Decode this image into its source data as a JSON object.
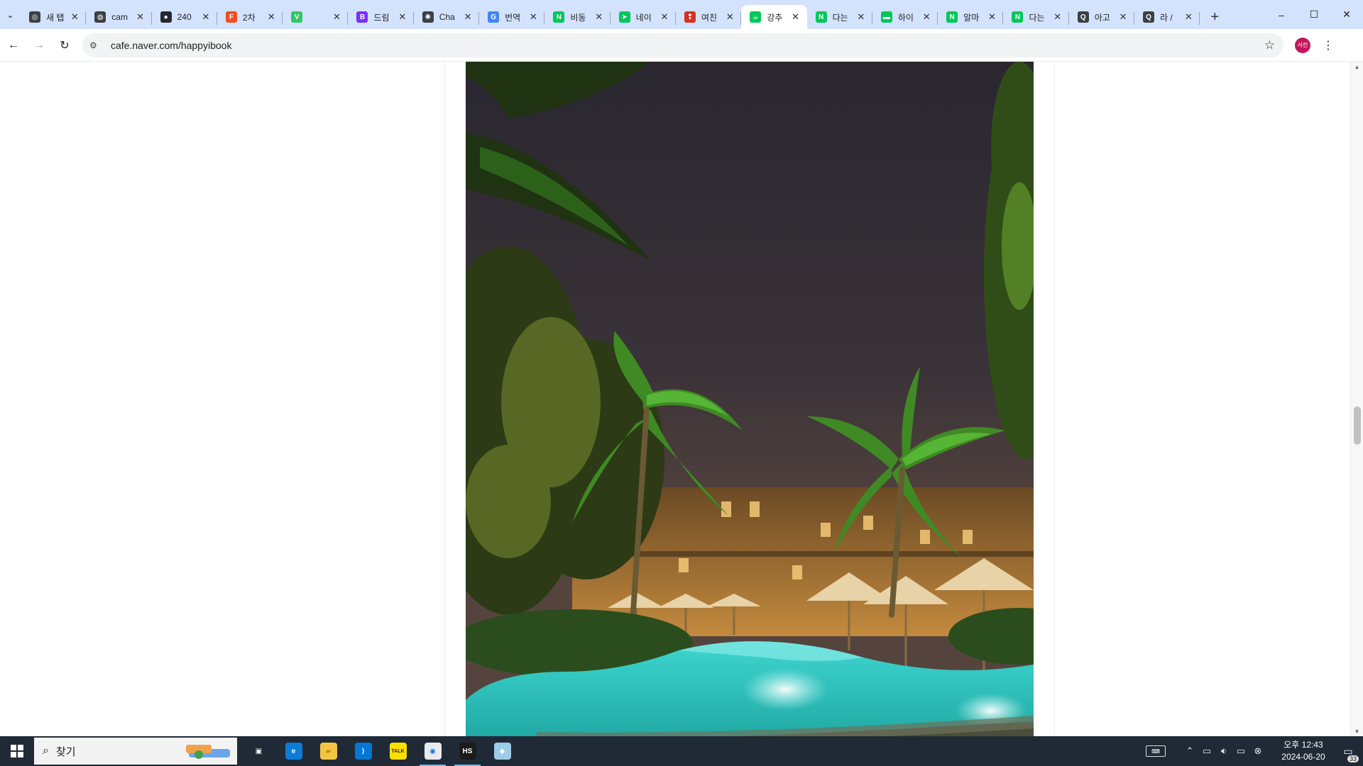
{
  "browser": {
    "tabs": [
      {
        "label": "새 탭",
        "icon": "chrome-icon",
        "color": "#3c4043",
        "glyph": "◎"
      },
      {
        "label": "cam",
        "icon": "globe-icon",
        "color": "#3c4043",
        "glyph": "◍"
      },
      {
        "label": "240",
        "icon": "github-icon",
        "color": "#24292f",
        "glyph": "●"
      },
      {
        "label": "2차",
        "icon": "figma-icon",
        "color": "#f24e1e",
        "glyph": "F"
      },
      {
        "label": "",
        "icon": "v-icon",
        "color": "#2ec866",
        "glyph": "V"
      },
      {
        "label": "드림",
        "icon": "b-icon",
        "color": "#7b2ff7",
        "glyph": "B"
      },
      {
        "label": "Cha",
        "icon": "openai-icon",
        "color": "#3c4043",
        "glyph": "✺"
      },
      {
        "label": "번역",
        "icon": "google-icon",
        "color": "#4285f4",
        "glyph": "G"
      },
      {
        "label": "비동",
        "icon": "naver-icon",
        "color": "#03c75a",
        "glyph": "N"
      },
      {
        "label": "네이",
        "icon": "bird-icon",
        "color": "#03c75a",
        "glyph": "➤"
      },
      {
        "label": "여친",
        "icon": "pin-icon",
        "color": "#d93025",
        "glyph": "❢"
      },
      {
        "label": "강추",
        "icon": "naver-cafe-icon",
        "color": "#03c75a",
        "glyph": "☕",
        "active": true
      },
      {
        "label": "다는",
        "icon": "naver-icon",
        "color": "#03c75a",
        "glyph": "N"
      },
      {
        "label": "하이",
        "icon": "chat-icon",
        "color": "#03c75a",
        "glyph": "▬"
      },
      {
        "label": "알마",
        "icon": "naver-icon",
        "color": "#03c75a",
        "glyph": "N"
      },
      {
        "label": "다는",
        "icon": "naver-icon",
        "color": "#03c75a",
        "glyph": "N"
      },
      {
        "label": "아고",
        "icon": "search-q-icon",
        "color": "#3c4043",
        "glyph": "Q"
      },
      {
        "label": "라 /",
        "icon": "search-q-icon",
        "color": "#3c4043",
        "glyph": "Q"
      }
    ],
    "new_tab": "+",
    "window_controls": {
      "minimize": "–",
      "maximize": "☐",
      "close": "✕"
    },
    "url": "cafe.naver.com/happyibook",
    "profile_initials": "서린"
  },
  "taskbar": {
    "search_placeholder": "찾기",
    "clock_time": "오후 12:43",
    "clock_date": "2024-06-20",
    "notification_count": "33",
    "apps": [
      {
        "name": "task-view",
        "glyph": "▣",
        "bg": "transparent",
        "fg": "#ffffff"
      },
      {
        "name": "edge",
        "glyph": "e",
        "bg": "#0c7bd6",
        "fg": "#ffffff"
      },
      {
        "name": "file-explorer",
        "glyph": "▰",
        "bg": "#f4c542",
        "fg": "#c28e0e"
      },
      {
        "name": "vscode",
        "glyph": "⟩",
        "bg": "#0078d4",
        "fg": "#ffffff"
      },
      {
        "name": "kakaotalk",
        "glyph": "TALK",
        "bg": "#f9e000",
        "fg": "#3a1d1d"
      },
      {
        "name": "chrome",
        "glyph": "◉",
        "bg": "#e8eaed",
        "fg": "#1a73e8",
        "running": true
      },
      {
        "name": "hs-app",
        "glyph": "HS",
        "bg": "#1b1b1b",
        "fg": "#ffffff",
        "running": true
      },
      {
        "name": "notes",
        "glyph": "◆",
        "bg": "#9ecbe8",
        "fg": "#ffffff"
      }
    ]
  }
}
